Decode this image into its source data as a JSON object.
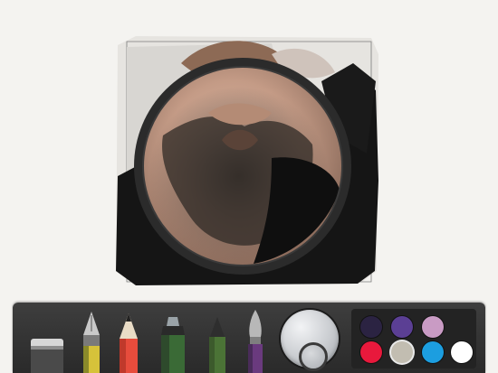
{
  "app": {
    "canvas": {
      "subject": "sketch"
    }
  },
  "toolbar": {
    "tools": [
      {
        "name": "eraser",
        "icon": "eraser-icon",
        "colors": [
          "#8c8c8c",
          "#c8c8c8"
        ]
      },
      {
        "name": "fountain-pen",
        "icon": "fountain-pen-icon",
        "colors": [
          "#8a8a2a",
          "#d6c23a"
        ]
      },
      {
        "name": "pencil",
        "icon": "pencil-icon",
        "colors": [
          "#c0392b",
          "#e74c3c"
        ]
      },
      {
        "name": "marker",
        "icon": "marker-icon",
        "colors": [
          "#2e4a2c",
          "#3a6a36"
        ]
      },
      {
        "name": "pen",
        "icon": "pen-icon",
        "colors": [
          "#3c5a2c",
          "#4b7336"
        ]
      },
      {
        "name": "brush",
        "icon": "brush-icon",
        "colors": [
          "#4a2c5a",
          "#6a3a7e"
        ]
      }
    ],
    "mixer": {
      "icon": "color-mixer-icon"
    },
    "palette": {
      "swatches": [
        "#2b2342",
        "#5b3f94",
        "#c99bc4",
        "#e8193c",
        "#c2bdb1",
        "#1c9ee0",
        "#ffffff"
      ],
      "selected": 4
    }
  }
}
